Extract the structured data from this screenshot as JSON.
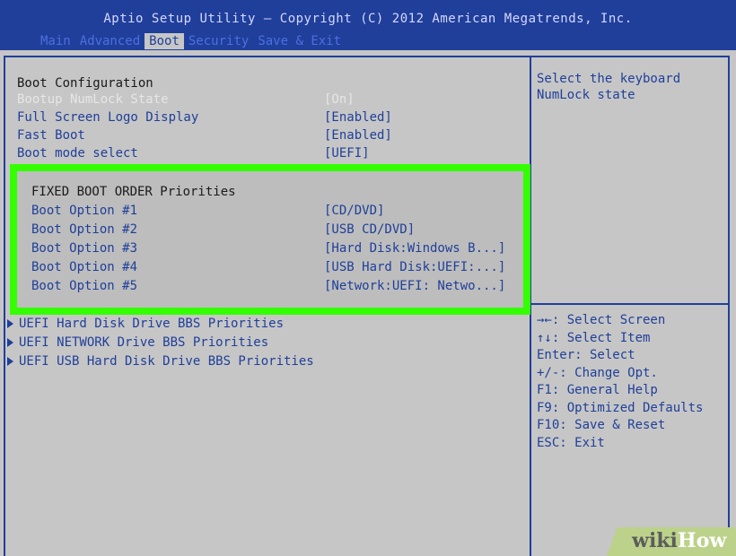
{
  "header": {
    "title": "Aptio Setup Utility – Copyright (C) 2012 American Megatrends, Inc.",
    "tabs": [
      "Main",
      "Advanced",
      "Boot",
      "Security",
      "Save & Exit"
    ],
    "active_tab": "Boot"
  },
  "boot_config": {
    "section_title": "Boot Configuration",
    "settings": [
      {
        "label": "Bootup NumLock State",
        "value": "[On]",
        "selected": true
      },
      {
        "label": "Full Screen Logo Display",
        "value": "[Enabled]"
      },
      {
        "label": "Fast Boot",
        "value": "[Enabled]"
      },
      {
        "label": "Boot mode select",
        "value": "[UEFI]"
      }
    ]
  },
  "boot_order": {
    "section_title": "FIXED BOOT ORDER Priorities",
    "options": [
      {
        "label": "Boot Option #1",
        "value": "[CD/DVD]"
      },
      {
        "label": "Boot Option #2",
        "value": "[USB CD/DVD]"
      },
      {
        "label": "Boot Option #3",
        "value": "[Hard Disk:Windows B...]"
      },
      {
        "label": "Boot Option #4",
        "value": "[USB Hard Disk:UEFI:...]"
      },
      {
        "label": "Boot Option #5",
        "value": "[Network:UEFI: Netwo...]"
      }
    ]
  },
  "submenus": [
    "UEFI Hard Disk Drive BBS Priorities",
    "UEFI NETWORK Drive BBS Priorities",
    "UEFI USB Hard Disk Drive BBS Priorities"
  ],
  "help": {
    "description": "Select the keyboard NumLock state",
    "keys": [
      "→←: Select Screen",
      "↑↓: Select Item",
      "Enter: Select",
      "+/-: Change Opt.",
      "F1: General Help",
      "F9: Optimized Defaults",
      "F10: Save & Reset",
      "ESC: Exit"
    ]
  },
  "watermark": {
    "part1": "wiki",
    "part2": "How"
  },
  "colors": {
    "header_bg": "#1f3f9a",
    "screen_bg": "#c6c6c6",
    "highlight_border": "#33ff00",
    "text_blue": "#1f3f9a"
  }
}
